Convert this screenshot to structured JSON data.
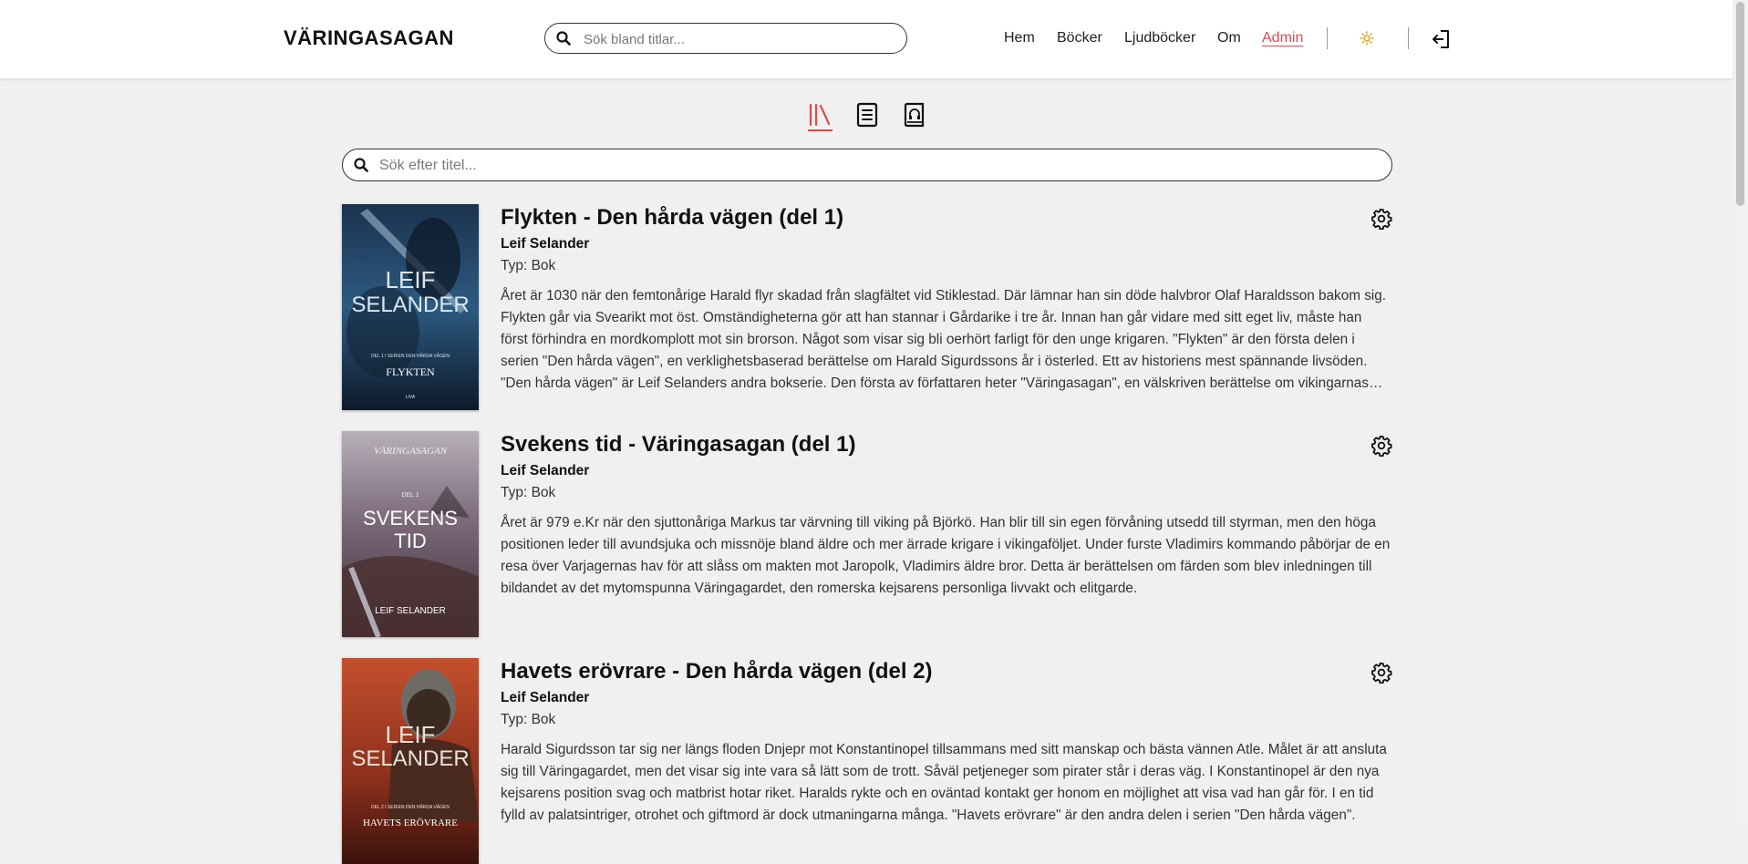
{
  "header": {
    "logo": "VÄRINGASAGAN",
    "search_placeholder": "Sök bland titlar...",
    "nav": [
      {
        "label": "Hem"
      },
      {
        "label": "Böcker"
      },
      {
        "label": "Ljudböcker"
      },
      {
        "label": "Om"
      },
      {
        "label": "Admin",
        "active": true
      }
    ],
    "theme_icon": "sun-icon",
    "logout_icon": "logout-icon"
  },
  "tabs": [
    {
      "icon": "library-icon",
      "active": true
    },
    {
      "icon": "book-icon",
      "active": false
    },
    {
      "icon": "audiobook-icon",
      "active": false
    }
  ],
  "search": {
    "placeholder": "Sök efter titel..."
  },
  "books": [
    {
      "title": "Flykten - Den hårda vägen (del 1)",
      "author": "Leif Selander",
      "type": "Typ: Bok",
      "description": "Året är 1030 när den femtonårige Harald flyr skadad från slagfältet vid Stiklestad. Där lämnar han sin döde halvbror Olaf Haraldsson bakom sig. Flykten går via Svearikt mot öst. Omständigheterna gör att han stannar i Gårdarike i tre år. Innan han går vidare med sitt eget liv, måste han först förhindra en mordkomplott mot sin brorson. Något som visar sig bli oerhört farligt för den unge krigaren. \"Flykten\" är den första delen i serien \"Den hårda vägen\", en verklighetsbaserad berättelse om Harald Sigurdssons år i österled. Ett av historiens mest spännande livsöden. \"Den hårda vägen\" är Leif Selanders andra bokserie. Den första av författaren heter \"Väringasagan\", en välskriven berättelse om vikingarnas tid.",
      "cover": {
        "line1": "LEIF",
        "line2": "SELANDER",
        "small": "DEL 1 I SERIEN DEN HÅRDA VÄGEN",
        "title": "FLYKTEN",
        "bottom": "LIVA"
      }
    },
    {
      "title": "Svekens tid - Väringasagan (del 1)",
      "author": "Leif Selander",
      "type": "Typ: Bok",
      "description": "Året är 979 e.Kr när den sjuttonåriga Markus tar värvning till viking på Björkö. Han blir till sin egen förvåning utsedd till styrman, men den höga positionen leder till avundsjuka och missnöje bland äldre och mer ärrade krigare i vikingaföljet. Under furste Vladimirs kommando påbörjar de en resa över Varjagernas hav för att slåss om makten mot Jaropolk, Vladimirs äldre bror. Detta är berättelsen om färden som blev inledningen till bildandet av det mytomspunna Väringagardet, den romerska kejsarens personliga livvakt och elitgarde.",
      "cover": {
        "top": "VÄRINGASAGAN",
        "del": "DEL 1",
        "line1": "SVEKENS",
        "line2": "TID",
        "bottom": "LEIF SELANDER"
      }
    },
    {
      "title": "Havets erövrare - Den hårda vägen (del 2)",
      "author": "Leif Selander",
      "type": "Typ: Bok",
      "description": "Harald Sigurdsson tar sig ner längs floden Dnjepr mot Konstantinopel tillsammans med sitt manskap och bästa vännen Atle. Målet är att ansluta sig till Väringagardet, men det visar sig inte vara så lätt som de trott. Såväl petjeneger som pirater står i deras väg. I Konstantinopel är den nya kejsarens position svag och matbrist hotar riket. Haralds rykte och en oväntad kontakt ger honom en möjlighet att visa vad han går för. I en tid fylld av palatsintriger, otrohet och giftmord är dock utmaningarna många. \"Havets erövrare\" är den andra delen i serien \"Den hårda vägen\".",
      "cover": {
        "line1": "LEIF",
        "line2": "SELANDER",
        "small": "DEL 2 I SERIEN DEN HÅRDA VÄGEN",
        "title": "HAVETS ERÖVRARE"
      }
    }
  ]
}
